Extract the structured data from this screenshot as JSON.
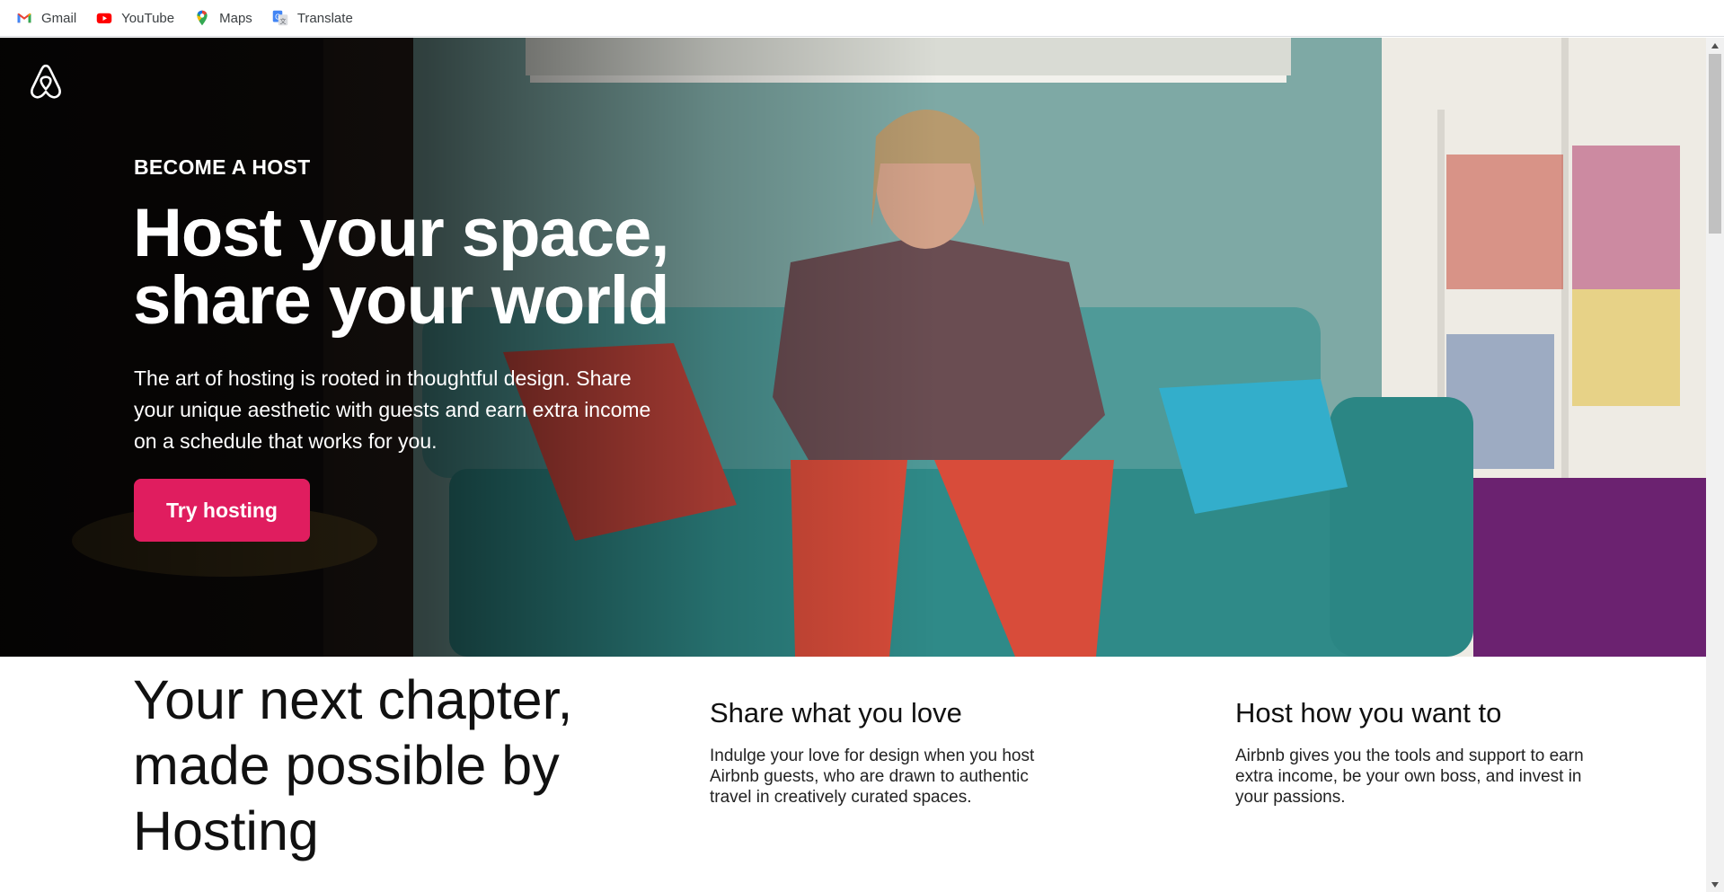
{
  "bookmarks": [
    {
      "label": "Gmail",
      "icon": "gmail-icon"
    },
    {
      "label": "YouTube",
      "icon": "youtube-icon"
    },
    {
      "label": "Maps",
      "icon": "maps-icon"
    },
    {
      "label": "Translate",
      "icon": "translate-icon"
    }
  ],
  "hero": {
    "eyebrow": "BECOME A HOST",
    "headline_line1": "Host your space,",
    "headline_line2": "share your world",
    "subtext": "The art of hosting is rooted in thoughtful design. Share your unique aesthetic with guests and earn extra income on a schedule that works for you.",
    "cta_label": "Try hosting",
    "accent_color": "#e01d5f",
    "logo_icon": "airbnb-logo-icon"
  },
  "chapter": {
    "title": "Your next chapter, made possible by Hosting"
  },
  "features": [
    {
      "title": "Share what you love",
      "body": "Indulge your love for design when you host Airbnb guests, who are drawn to authentic travel in creatively curated spaces."
    },
    {
      "title": "Host how you want to",
      "body": "Airbnb gives you the tools and support to earn extra income, be your own boss, and invest in your passions."
    }
  ]
}
